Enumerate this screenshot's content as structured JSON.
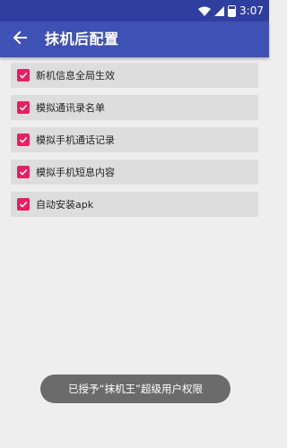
{
  "status_bar": {
    "time": "3:07",
    "icons": [
      "wifi-icon",
      "cell-signal-icon",
      "battery-icon"
    ]
  },
  "app_bar": {
    "back_icon": "arrow-left-icon",
    "title": "抹机后配置"
  },
  "settings": [
    {
      "label": "新机信息全局生效",
      "checked": true
    },
    {
      "label": "模拟通讯录名单",
      "checked": true
    },
    {
      "label": "模拟手机通话记录",
      "checked": true
    },
    {
      "label": "模拟手机短息内容",
      "checked": true
    },
    {
      "label": "自动安装apk",
      "checked": true
    }
  ],
  "toast": {
    "message": "已授予“抹机王”超级用户权限"
  },
  "colors": {
    "status_bar": "#303f9f",
    "app_bar": "#3f51b5",
    "checkbox_accent": "#e91e63",
    "background": "#eeeeee"
  }
}
